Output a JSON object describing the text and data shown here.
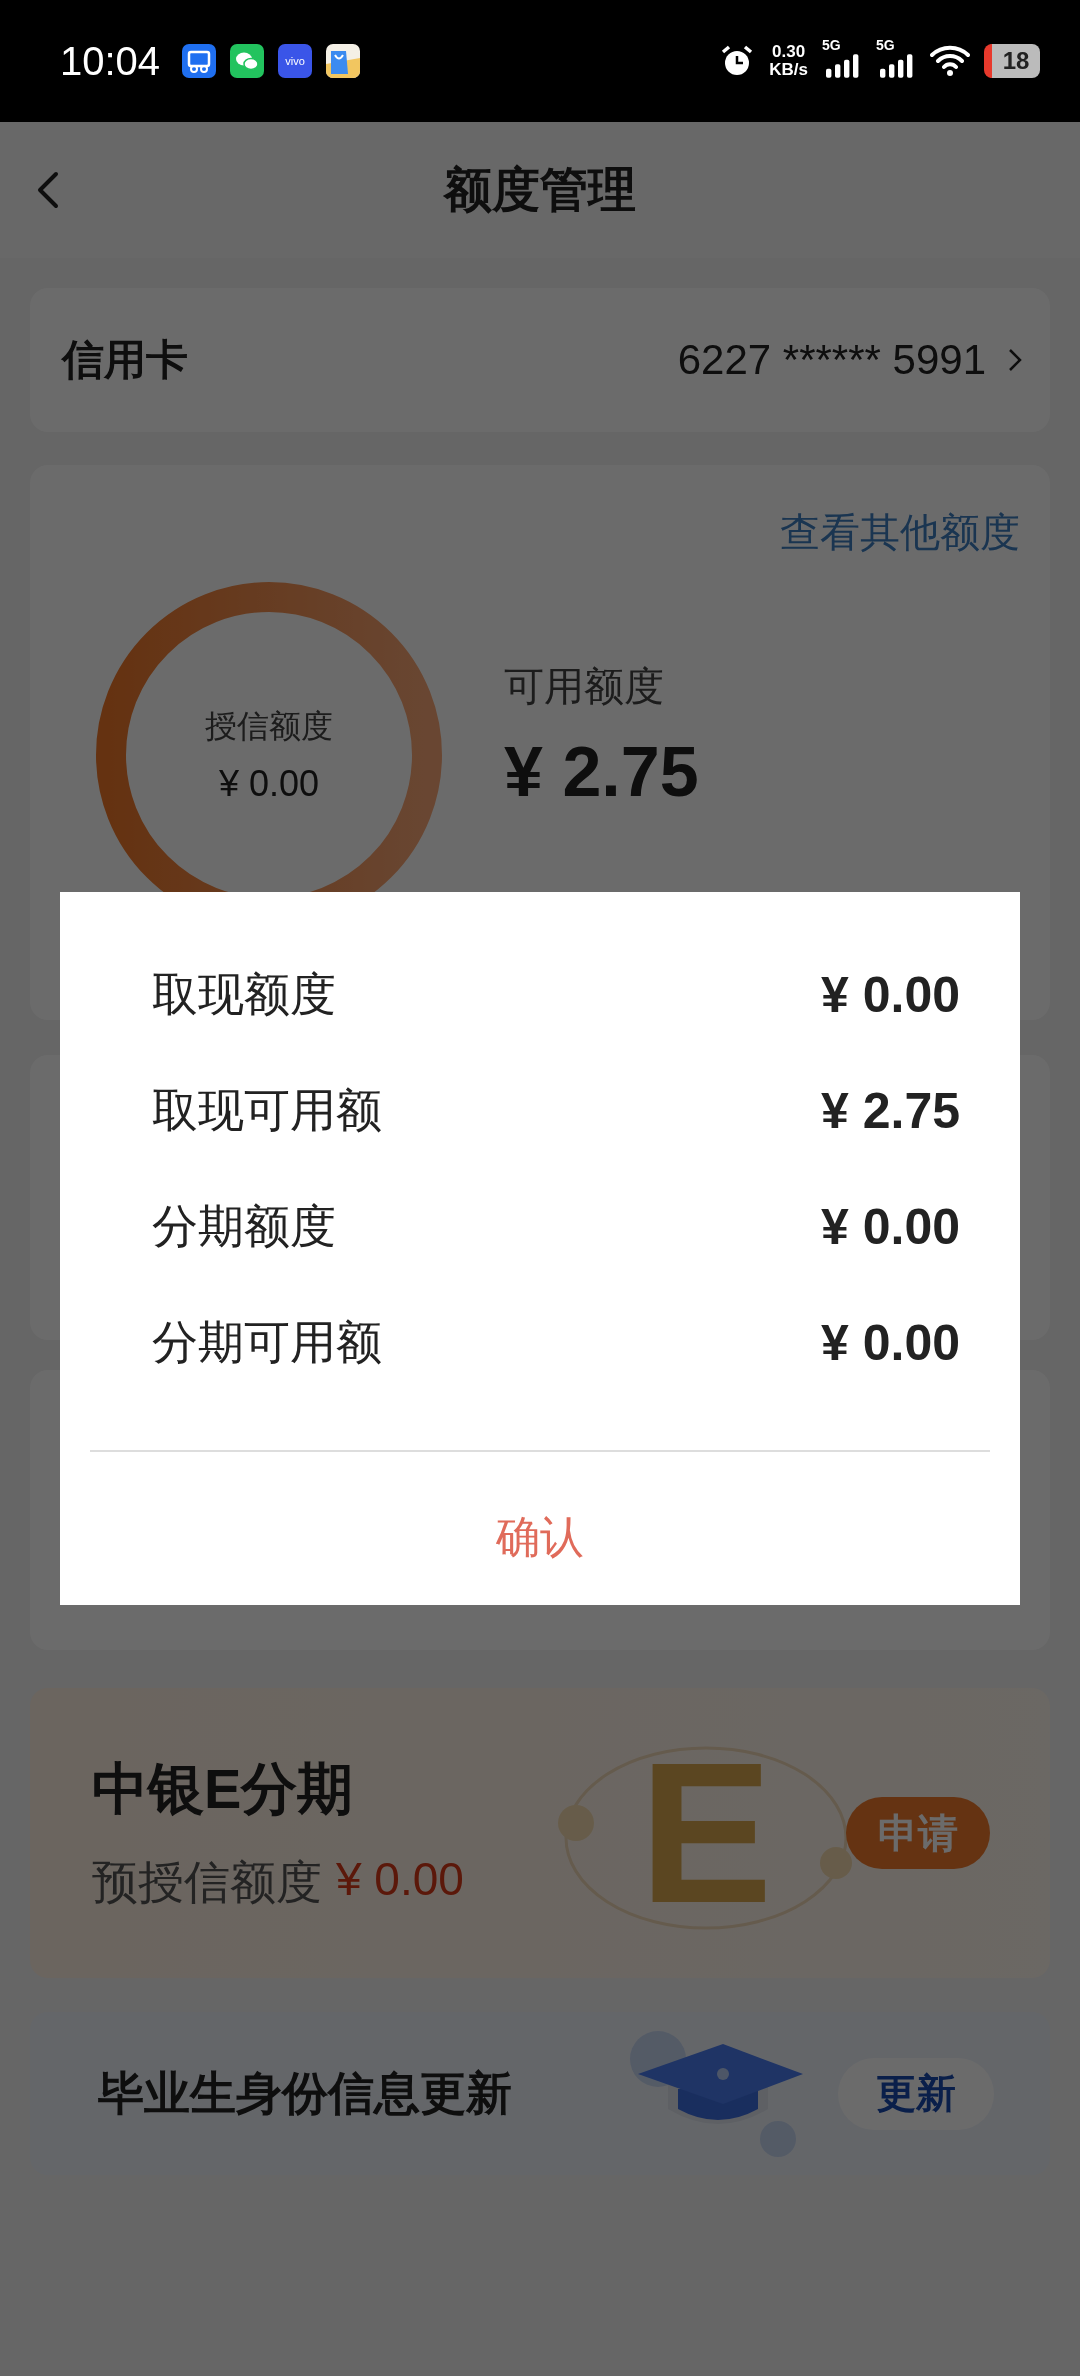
{
  "status_bar": {
    "time": "10:04",
    "vivo_label": "vivo",
    "net_speed": "0.30",
    "net_unit": "KB/s",
    "signals": [
      "5G",
      "5G"
    ],
    "battery": "18"
  },
  "nav": {
    "title": "额度管理"
  },
  "card": {
    "label": "信用卡",
    "number": "6227 ****** 5991"
  },
  "quota": {
    "link": "查看其他额度",
    "ring_label": "授信额度",
    "ring_value": "¥ 0.00",
    "available_label": "可用额度",
    "available_value": "¥ 2.75"
  },
  "promo": {
    "title": "中银E分期",
    "amount_label": "预授信额度",
    "amount_value": "¥ 0.00",
    "decor_letter": "E",
    "button": "申请"
  },
  "graduate": {
    "title": "毕业生身份信息更新",
    "button": "更新"
  },
  "dialog": {
    "rows": [
      {
        "label": "取现额度",
        "value": "¥ 0.00"
      },
      {
        "label": "取现可用额",
        "value": "¥ 2.75"
      },
      {
        "label": "分期额度",
        "value": "¥ 0.00"
      },
      {
        "label": "分期可用额",
        "value": "¥ 0.00"
      }
    ],
    "confirm": "确认"
  }
}
